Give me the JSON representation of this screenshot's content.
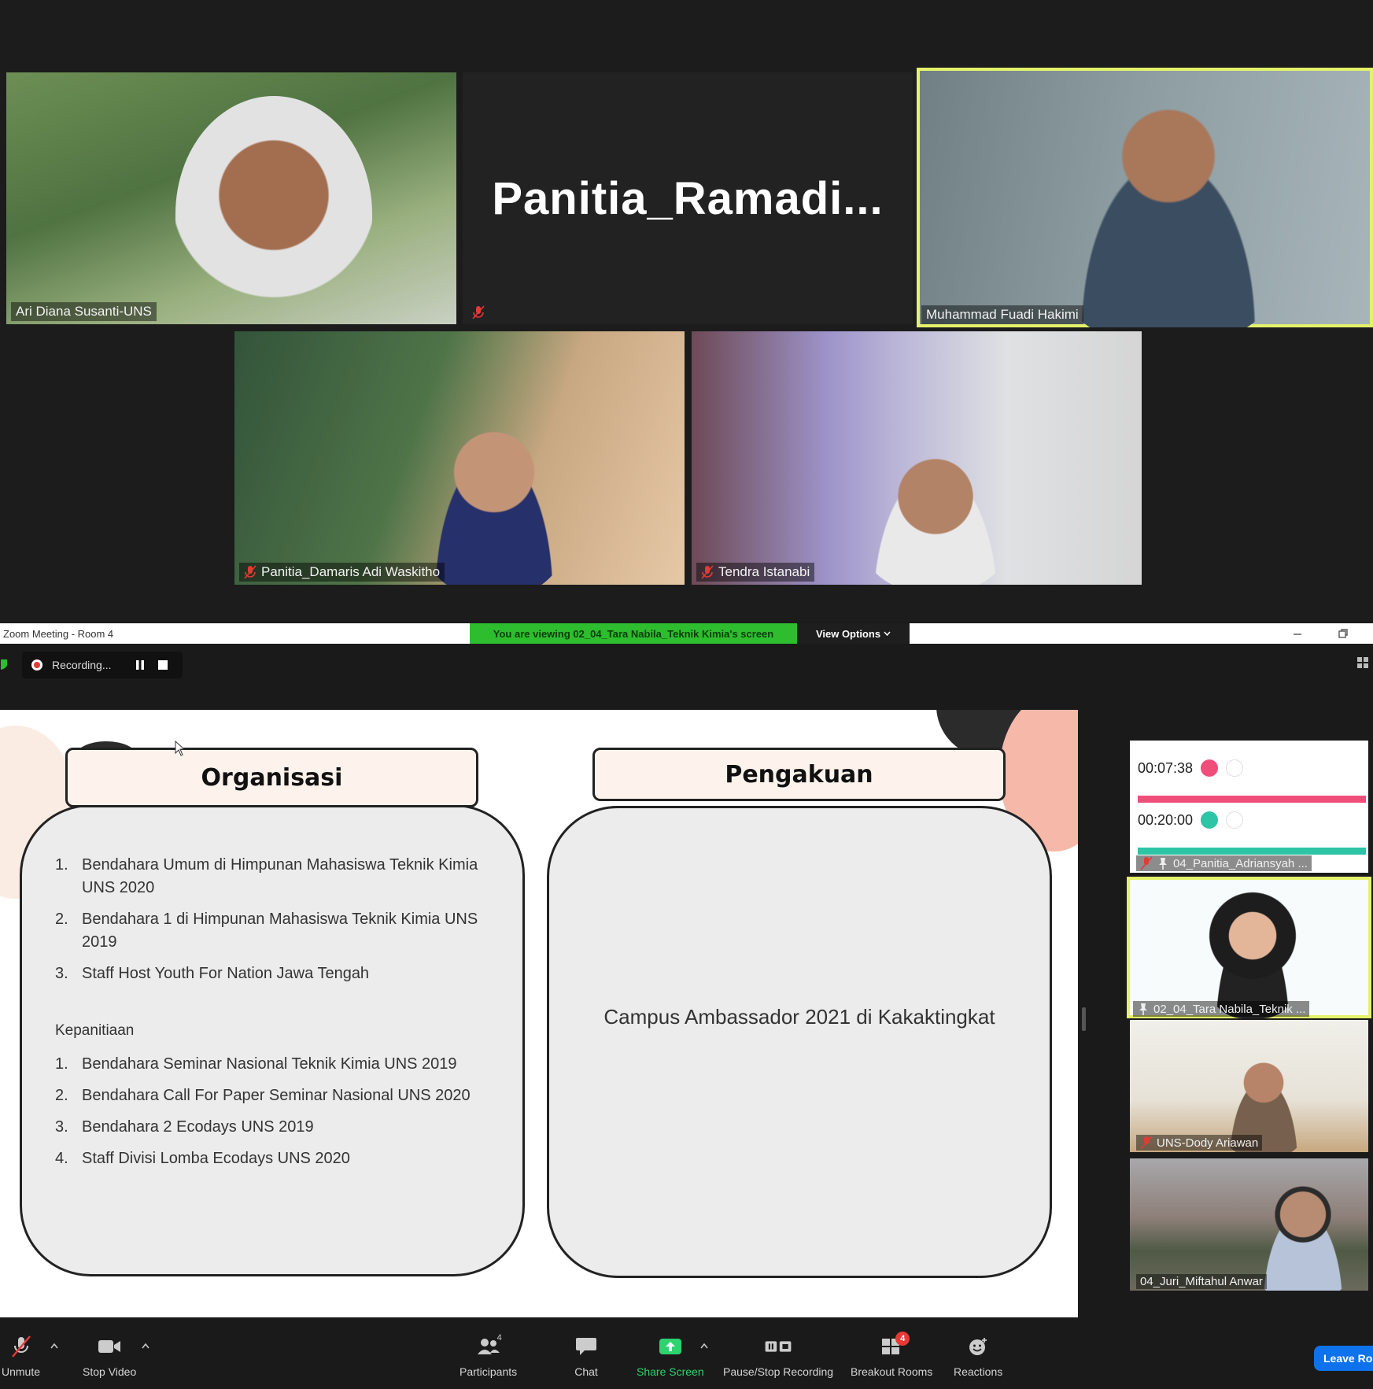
{
  "gallery": {
    "tiles": [
      {
        "name": "Ari Diana Susanti-UNS"
      },
      {
        "name": "Panitia_Ramadi..."
      },
      {
        "name": "Muhammad Fuadi Hakimi"
      },
      {
        "name": "Panitia_Damaris Adi Waskitho"
      },
      {
        "name": "Tendra Istanabi"
      }
    ]
  },
  "zoom": {
    "window_title": "Zoom Meeting - Room 4",
    "viewing_banner": "You are viewing 02_04_Tara Nabila_Teknik Kimia's screen",
    "view_options": "View Options",
    "recording": "Recording...",
    "slide": {
      "left_title": "Organisasi",
      "organisasi": [
        {
          "num": "1.",
          "text": "Bendahara Umum di Himpunan Mahasiswa Teknik Kimia UNS 2020"
        },
        {
          "num": "2.",
          "text": "Bendahara 1 di Himpunan Mahasiswa Teknik Kimia UNS 2019"
        },
        {
          "num": "3.",
          "text": "Staff Host Youth For Nation Jawa Tengah"
        }
      ],
      "kepanitiaan_heading": "Kepanitiaan",
      "kepanitiaan": [
        {
          "num": "1.",
          "text": "Bendahara Seminar Nasional Teknik Kimia UNS 2019"
        },
        {
          "num": "2.",
          "text": "Bendahara Call For Paper Seminar Nasional UNS  2020"
        },
        {
          "num": "3.",
          "text": "Bendahara 2 Ecodays UNS 2019"
        },
        {
          "num": "4.",
          "text": "Staff Divisi Lomba Ecodays UNS 2020"
        }
      ],
      "right_title": "Pengakuan",
      "right_text": "Campus Ambassador 2021 di Kakaktingkat"
    },
    "thumbnails": [
      {
        "name": "04_Panitia_Adriansyah ...",
        "timer1": "00:07:38",
        "timer2": "00:20:00"
      },
      {
        "name": "02_04_Tara Nabila_Teknik ..."
      },
      {
        "name": "UNS-Dody Ariawan"
      },
      {
        "name": "04_Juri_Miftahul Anwar"
      }
    ],
    "toolbar": {
      "unmute": "Unmute",
      "stop_video": "Stop Video",
      "participants": "Participants",
      "participants_count": "4",
      "chat": "Chat",
      "share_screen": "Share Screen",
      "pause_stop_recording": "Pause/Stop Recording",
      "breakout_rooms": "Breakout Rooms",
      "breakout_badge": "4",
      "reactions": "Reactions",
      "leave": "Leave Ro"
    }
  },
  "colors": {
    "active_speaker": "#e4f26b",
    "banner_green": "#2ebd2e",
    "share_green": "#2dd36f",
    "leave_blue": "#0e72ed",
    "timer_pink": "#f04e7a",
    "timer_teal": "#2ec4a6"
  }
}
